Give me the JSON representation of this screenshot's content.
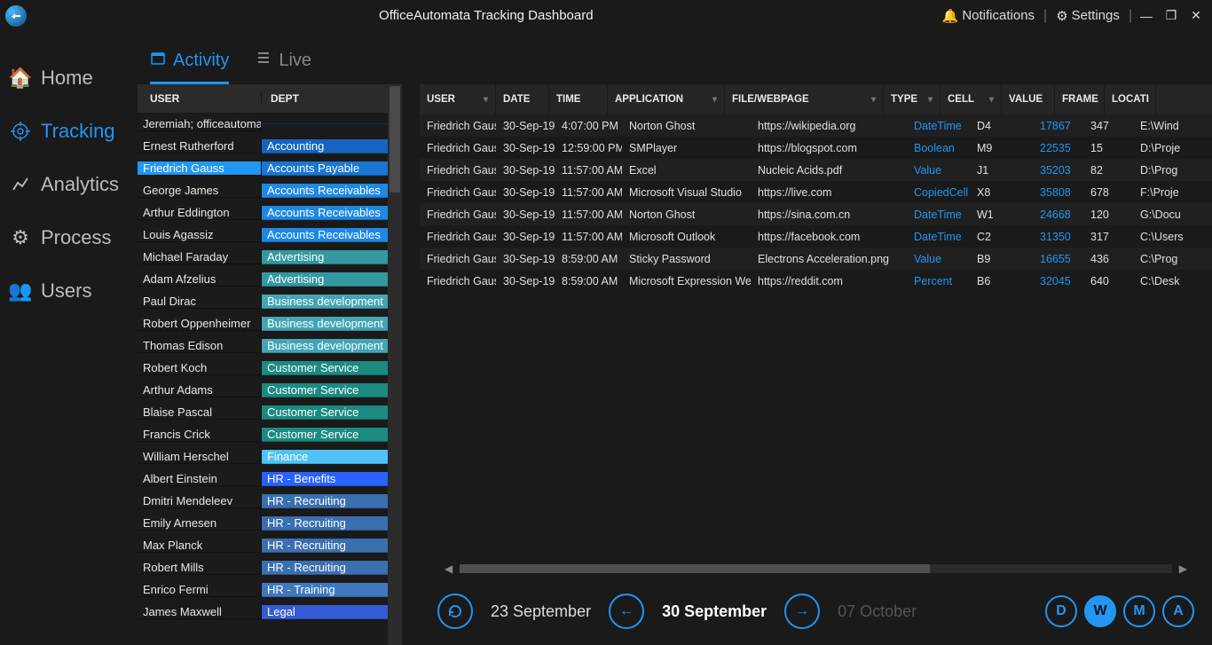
{
  "titlebar": {
    "title": "OfficeAutomata Tracking Dashboard",
    "notifications": "Notifications",
    "settings": "Settings"
  },
  "sidebar": {
    "items": [
      {
        "label": "Home"
      },
      {
        "label": "Tracking"
      },
      {
        "label": "Analytics"
      },
      {
        "label": "Process"
      },
      {
        "label": "Users"
      }
    ]
  },
  "tabs": {
    "activity": "Activity",
    "live": "Live"
  },
  "userDept": {
    "head": {
      "user": "USER",
      "dept": "DEPT"
    },
    "rows": [
      {
        "user": "Jeremiah; officeautomata",
        "dept": "",
        "cls": "d-blank"
      },
      {
        "user": "Ernest Rutherford",
        "dept": "Accounting",
        "cls": "d-acc"
      },
      {
        "user": "Friedrich Gauss",
        "dept": "Accounts Payable",
        "cls": "d-ap",
        "selected": true
      },
      {
        "user": "George James",
        "dept": "Accounts Receivables",
        "cls": "d-ar"
      },
      {
        "user": "Arthur Eddington",
        "dept": "Accounts Receivables",
        "cls": "d-ar"
      },
      {
        "user": "Louis Agassiz",
        "dept": "Accounts Receivables",
        "cls": "d-ar"
      },
      {
        "user": "Michael Faraday",
        "dept": "Advertising",
        "cls": "d-adv"
      },
      {
        "user": "Adam Afzelius",
        "dept": "Advertising",
        "cls": "d-adv"
      },
      {
        "user": "Paul Dirac",
        "dept": "Business development",
        "cls": "d-bd"
      },
      {
        "user": "Robert Oppenheimer",
        "dept": "Business development",
        "cls": "d-bd"
      },
      {
        "user": "Thomas Edison",
        "dept": "Business development",
        "cls": "d-bd"
      },
      {
        "user": "Robert Koch",
        "dept": "Customer Service",
        "cls": "d-cs"
      },
      {
        "user": "Arthur Adams",
        "dept": "Customer Service",
        "cls": "d-cs"
      },
      {
        "user": "Blaise Pascal",
        "dept": "Customer Service",
        "cls": "d-cs"
      },
      {
        "user": "Francis Crick",
        "dept": "Customer Service",
        "cls": "d-cs"
      },
      {
        "user": "William Herschel",
        "dept": "Finance",
        "cls": "d-fin"
      },
      {
        "user": "Albert Einstein",
        "dept": "HR - Benefits",
        "cls": "d-hrb"
      },
      {
        "user": "Dmitri Mendeleev",
        "dept": "HR - Recruiting",
        "cls": "d-hrr"
      },
      {
        "user": "Emily Arnesen",
        "dept": "HR - Recruiting",
        "cls": "d-hrr"
      },
      {
        "user": "Max Planck",
        "dept": "HR - Recruiting",
        "cls": "d-hrr"
      },
      {
        "user": "Robert Mills",
        "dept": "HR - Recruiting",
        "cls": "d-hrr"
      },
      {
        "user": "Enrico Fermi",
        "dept": "HR - Training",
        "cls": "d-hrt"
      },
      {
        "user": "James Maxwell",
        "dept": "Legal",
        "cls": "d-leg"
      }
    ]
  },
  "grid": {
    "columns": {
      "user": "USER",
      "date": "DATE",
      "time": "TIME",
      "app": "APPLICATION",
      "file": "FILE/WEBPAGE",
      "type": "TYPE",
      "cell": "CELL",
      "value": "VALUE",
      "frame": "FRAME",
      "location": "LOCATI"
    },
    "rows": [
      {
        "user": "Friedrich Gauss",
        "date": "30-Sep-19",
        "time": "4:07:00 PM",
        "app": "Norton Ghost",
        "file": "https://wikipedia.org",
        "type": "DateTime",
        "cell": "D4",
        "value": "17867",
        "frame": "347",
        "loc": "E:\\Wind"
      },
      {
        "user": "Friedrich Gauss",
        "date": "30-Sep-19",
        "time": "12:59:00 PM",
        "app": "SMPlayer",
        "file": "https://blogspot.com",
        "type": "Boolean",
        "cell": "M9",
        "value": "22535",
        "frame": "15",
        "loc": "D:\\Proje"
      },
      {
        "user": "Friedrich Gauss",
        "date": "30-Sep-19",
        "time": "11:57:00 AM",
        "app": "Excel",
        "file": "Nucleic Acids.pdf",
        "type": "Value",
        "cell": "J1",
        "value": "35203",
        "frame": "82",
        "loc": "D:\\Prog"
      },
      {
        "user": "Friedrich Gauss",
        "date": "30-Sep-19",
        "time": "11:57:00 AM",
        "app": "Microsoft Visual Studio",
        "file": "https://live.com",
        "type": "CopiedCell",
        "cell": "X8",
        "value": "35808",
        "frame": "678",
        "loc": "F:\\Proje"
      },
      {
        "user": "Friedrich Gauss",
        "date": "30-Sep-19",
        "time": "11:57:00 AM",
        "app": "Norton Ghost",
        "file": "https://sina.com.cn",
        "type": "DateTime",
        "cell": "W1",
        "value": "24668",
        "frame": "120",
        "loc": "G:\\Docu"
      },
      {
        "user": "Friedrich Gauss",
        "date": "30-Sep-19",
        "time": "11:57:00 AM",
        "app": "Microsoft Outlook",
        "file": "https://facebook.com",
        "type": "DateTime",
        "cell": "C2",
        "value": "31350",
        "frame": "317",
        "loc": "C:\\Users"
      },
      {
        "user": "Friedrich Gauss",
        "date": "30-Sep-19",
        "time": "8:59:00 AM",
        "app": "Sticky Password",
        "file": "Electrons Acceleration.png",
        "type": "Value",
        "cell": "B9",
        "value": "16655",
        "frame": "436",
        "loc": "C:\\Prog"
      },
      {
        "user": "Friedrich Gauss",
        "date": "30-Sep-19",
        "time": "8:59:00 AM",
        "app": "Microsoft Expression Web",
        "file": "https://reddit.com",
        "type": "Percent",
        "cell": "B6",
        "value": "32045",
        "frame": "640",
        "loc": "C:\\Desk"
      }
    ]
  },
  "dateNav": {
    "prevWeek": "23 September",
    "current": "30 September",
    "nextWeek": "07 October",
    "ranges": {
      "d": "D",
      "w": "W",
      "m": "M",
      "a": "A"
    }
  }
}
